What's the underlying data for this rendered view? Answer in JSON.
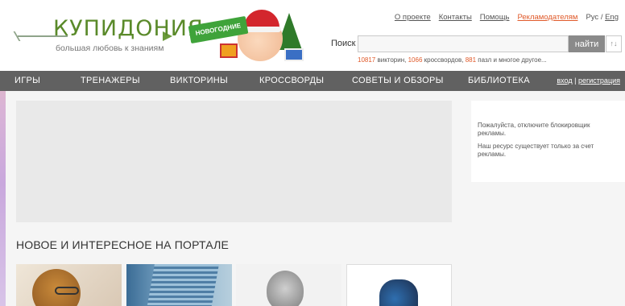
{
  "logo": {
    "title": "КУПИДОНИЯ",
    "subtitle": "большая любовь к знаниям"
  },
  "promo": {
    "banner_text": "НОВОГОДНИЕ"
  },
  "top_links": {
    "about": "О проекте",
    "contacts": "Контакты",
    "help": "Помощь",
    "advertisers": "Рекламодателям",
    "lang_ru": "Рус",
    "lang_sep": "/",
    "lang_en": "Eng"
  },
  "search": {
    "label": "Поиск",
    "value": "",
    "placeholder": "",
    "button": "найти",
    "sort_button": "↑↓"
  },
  "stats": {
    "quizzes_count": "10817",
    "quizzes_label": " викторин, ",
    "crosswords_count": "1066",
    "crosswords_label": " кроссвордов, ",
    "puzzles_count": "881",
    "puzzles_label": " пазл и многое другое..."
  },
  "nav": {
    "items": [
      "ИГРЫ",
      "ТРЕНАЖЕРЫ",
      "ВИКТОРИНЫ",
      "КРОССВОРДЫ",
      "СОВЕТЫ И ОБЗОРЫ",
      "БИБЛИОТЕКА"
    ],
    "login": "вход",
    "separator": "|",
    "register": "регистрация"
  },
  "section": {
    "title": "НОВОЕ И ИНТЕРЕСНОЕ НА ПОРТАЛЕ"
  },
  "sidebar": {
    "message_1": "Пожалуйста, отключите блокировщик рекламы.",
    "message_2": "Наш ресурс существует только за счет рекламы."
  },
  "colors": {
    "nav_bg": "#616161",
    "accent": "#e05a2a",
    "brand_green": "#5a8a2a"
  }
}
